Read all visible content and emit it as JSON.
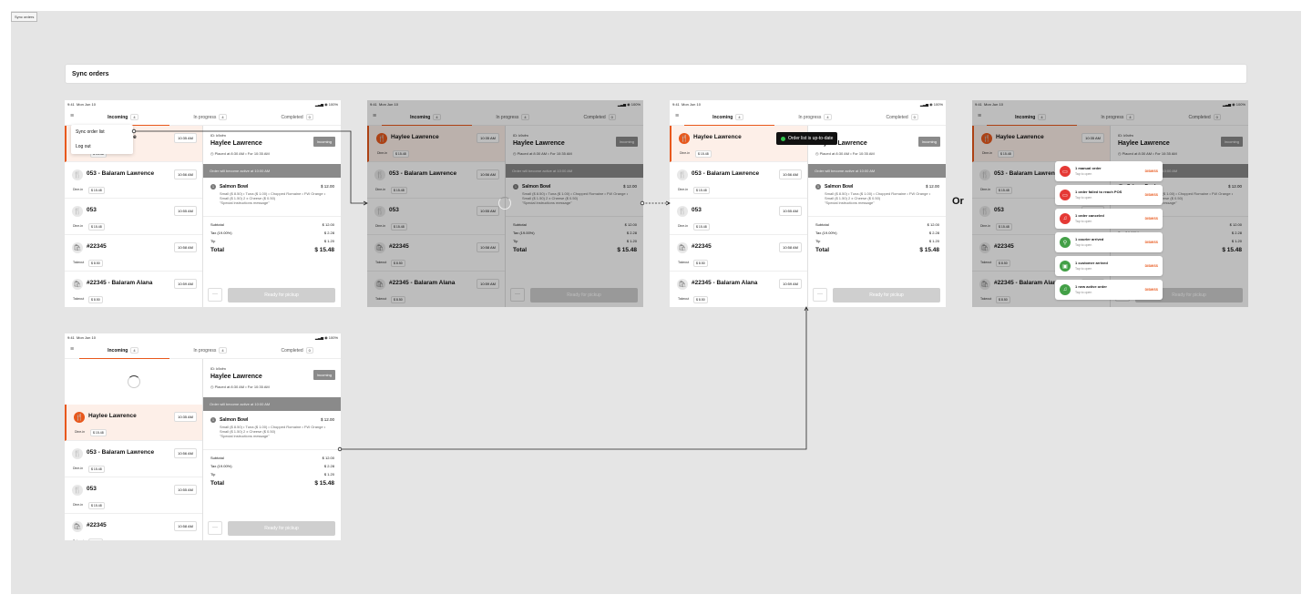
{
  "page_chip": "Sync orders",
  "section_title": "Sync orders",
  "or_label": "Or",
  "status_bar": {
    "time": "9:41",
    "date": "Mon Jun 10",
    "battery": "100%"
  },
  "tabs": {
    "incoming": {
      "label": "Incoming",
      "count": "4"
    },
    "in_progress": {
      "label": "In progress",
      "count": "4"
    },
    "completed": {
      "label": "Completed",
      "count": "0"
    }
  },
  "menu": {
    "sync": "Sync order list",
    "logout": "Log out"
  },
  "orders": [
    {
      "name": "Haylee Lawrence",
      "time": "10:35 AM",
      "type": "Dine-in",
      "price": "$ 15.48"
    },
    {
      "name": "053 - Balaram Lawrence",
      "time": "10:56 AM",
      "type": "Dine-in",
      "price": "$ 15.48"
    },
    {
      "name": "053",
      "time": "10:55 AM",
      "type": "Dine-in",
      "price": "$ 15.48"
    },
    {
      "name": "#22345",
      "time": "10:58 AM",
      "type": "Takeout",
      "price": "$ 8.50"
    },
    {
      "name": "#22345 - Balaram Alana",
      "time": "10:59 AM",
      "type": "Takeout",
      "price": "$ 8.50"
    }
  ],
  "detail": {
    "id": "ID: k9cfm",
    "customer": "Haylee Lawrence",
    "placed": "Placed at 8:30 AM • For 10:35 AM",
    "badge": "Incoming",
    "banner": "Order will become active at 10:00 AM",
    "item": {
      "qty": "1",
      "name": "Salmon Bowl",
      "price": "$ 12.00",
      "desc": "Small ($ 8.50) • Tuna ($ 1.00) • Chopped Romaine • FW Orange • Small ($ 1.50) 2 x Cheese ($ 0.50)",
      "note": "\"Special instructions message\""
    },
    "subtotal_label": "Subtotal",
    "subtotal": "$ 12.00",
    "tax_label": "Tax (19.00%)",
    "tax": "$ 2.28",
    "tip_label": "Tip",
    "tip": "$ 1.20",
    "total_label": "Total",
    "total": "$ 15.48",
    "more": "···",
    "ready": "Ready for pickup"
  },
  "toast": "Order list is up-to-date",
  "notifications": [
    {
      "title": "1 manual order",
      "sub": "Tap to open",
      "dismiss": "DISMISS",
      "color": "#e53935",
      "icon": "monitor-icon"
    },
    {
      "title": "1 order failed to reach POS",
      "sub": "Tap to open",
      "dismiss": "DISMISS",
      "color": "#e53935",
      "icon": "monitor-icon"
    },
    {
      "title": "1 order canceled",
      "sub": "Tap to open",
      "dismiss": "DISMISS",
      "color": "#e53935",
      "icon": "bell-icon"
    },
    {
      "title": "1 courier arrived",
      "sub": "Tap to open",
      "dismiss": "DISMISS",
      "color": "#43a047",
      "icon": "bike-icon"
    },
    {
      "title": "1 customer arrived",
      "sub": "Tap to open",
      "dismiss": "DISMISS",
      "color": "#43a047",
      "icon": "bag-icon"
    },
    {
      "title": "1 new active order",
      "sub": "Tap to open",
      "dismiss": "DISMISS",
      "color": "#43a047",
      "icon": "bell-icon"
    }
  ],
  "colors": {
    "accent": "#e8581c",
    "canvas": "#e5e5e5",
    "badge": "#8a8a8a",
    "success": "#32c24d"
  }
}
